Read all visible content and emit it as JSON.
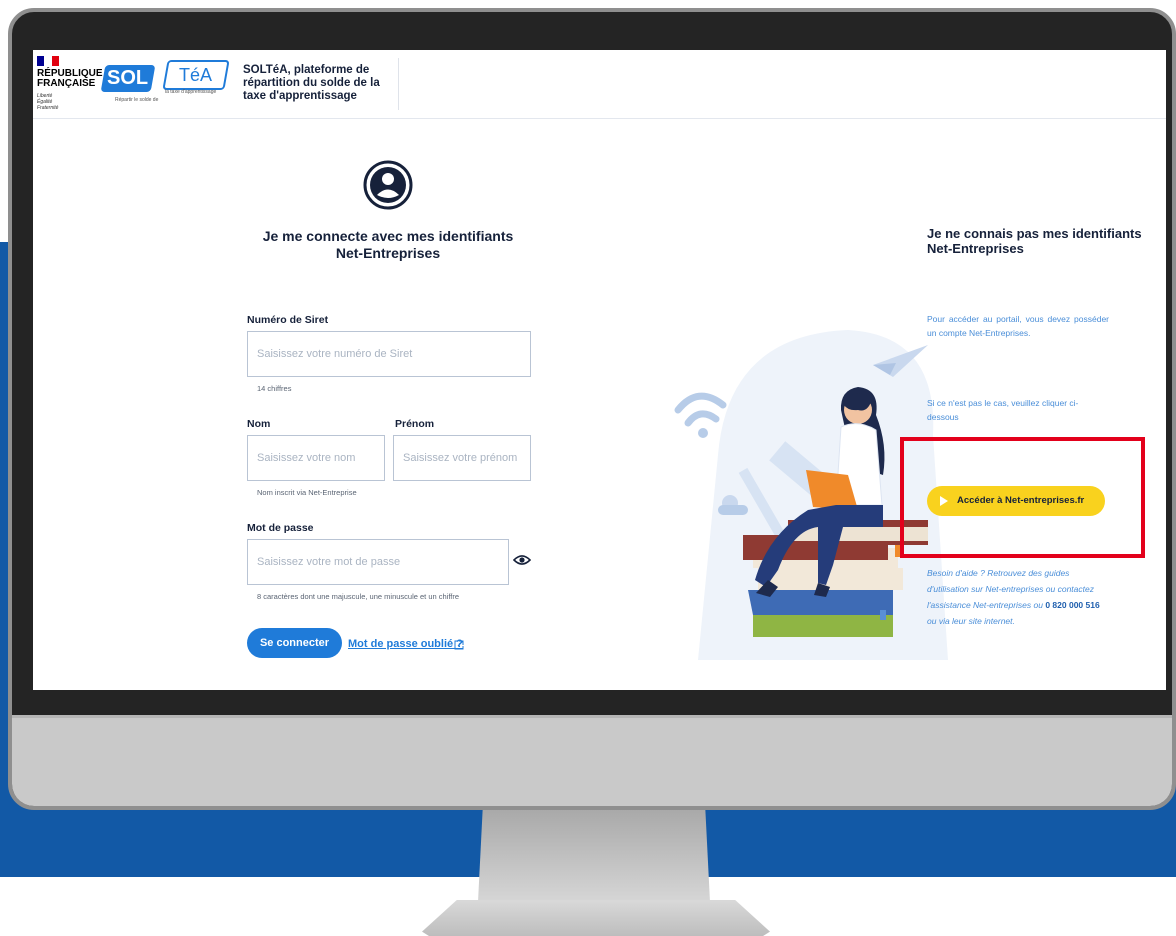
{
  "header": {
    "gov_name_line1": "RÉPUBLIQUE",
    "gov_name_line2": "FRANÇAISE",
    "gov_motto": "Liberté Égalité Fraternité",
    "logo_sol": "SOL",
    "logo_tea": "TéA",
    "logo_tagline1": "Répartir le solde de",
    "logo_tagline2": "la taxe d'apprentissage",
    "app_title": "SOLTéA, plateforme de répartition du solde de la taxe d'apprentissage"
  },
  "login": {
    "title_line1": "Je me connecte avec mes identifiants",
    "title_line2": "Net-Entreprises",
    "siret": {
      "label": "Numéro de Siret",
      "placeholder": "Saisissez votre numéro de Siret",
      "hint": "14 chiffres"
    },
    "nom": {
      "label": "Nom",
      "placeholder": "Saisissez votre nom"
    },
    "prenom": {
      "label": "Prénom",
      "placeholder": "Saisissez votre prénom"
    },
    "nom_hint": "Nom inscrit via Net-Entreprise",
    "password": {
      "label": "Mot de passe",
      "placeholder": "Saisissez votre mot de passe",
      "hint": "8 caractères dont une majuscule, une minuscule et un chiffre"
    },
    "connect_button": "Se connecter",
    "forgot_link": "Mot de passe oublié ?"
  },
  "no_account": {
    "title_line1": "Je ne connais pas mes identifiants",
    "title_line2": "Net-Entreprises",
    "info1": "Pour accéder au portail, vous devez posséder un compte Net-Entreprises.",
    "info2": "Si ce n'est pas le cas, veuillez cliquer ci-dessous",
    "button": "Accéder à Net-entreprises.fr",
    "help_text": "Besoin d'aide ? Retrouvez des guides d'utilisation sur Net-entreprises ou contactez l'assistance Net-entreprises ou",
    "help_phone": "0 820 000 516",
    "help_suffix": "ou via leur site internet."
  },
  "colors": {
    "primary": "#1f7bd9",
    "accent_yellow": "#f9d21e",
    "background_blue": "#1259a6",
    "highlight_red": "#e3001b",
    "title_text": "#16213a"
  },
  "icons": [
    "user-circle-icon",
    "eye-icon",
    "external-link-icon",
    "play-icon"
  ]
}
